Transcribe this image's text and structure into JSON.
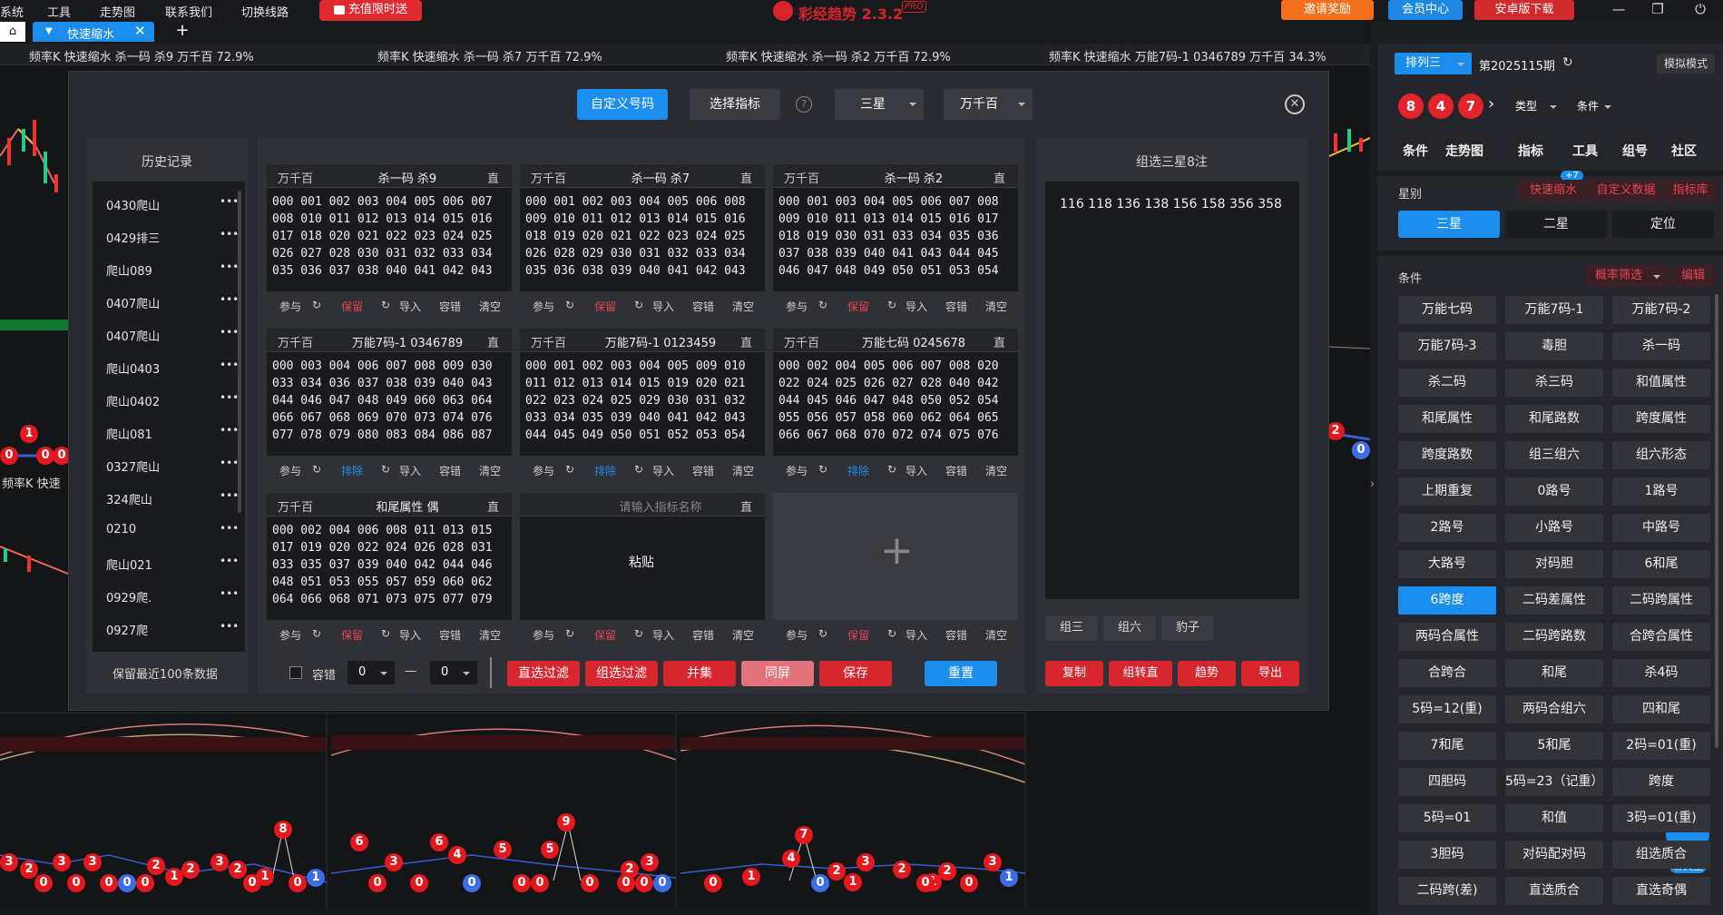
{
  "menu": [
    "系统",
    "工具",
    "走势图",
    "联系我们",
    "切换线路"
  ],
  "recharge": "充值限时送",
  "brand": {
    "name": "彩经趋势 2.3.2",
    "badge": "PRO"
  },
  "invite": "邀请奖励",
  "member": "会员中心",
  "android": "安卓版下载",
  "tabs": {
    "active": "快速缩水"
  },
  "chart_headers": [
    "频率K 快速缩水 杀一码 杀9 万千百 72.9%",
    "频率K 快速缩水 杀一码 杀7 万千百 72.9%",
    "频率K 快速缩水 杀一码 杀2 万千百 72.9%",
    "频率K 快速缩水 万能7码-1 0346789 万千百 34.3%"
  ],
  "chart_label_small": "频率K 快速",
  "dialog": {
    "custom_btn": "自定义号码",
    "select_btn": "选择指标",
    "help_icon": "?",
    "star_select": "三星",
    "pos_select": "万千百"
  },
  "history": {
    "title": "历史记录",
    "items": [
      "0430爬山",
      "0429排三",
      "爬山089",
      "0407爬山",
      "0407爬山",
      "爬山0403",
      "爬山0402",
      "爬山081",
      "0327爬山",
      "324爬山",
      "0210",
      "爬山021",
      "0929爬.",
      "0927爬"
    ],
    "dots": "•••",
    "footer": "保留最近100条数据"
  },
  "filters": [
    {
      "pos": "万千百",
      "name": "杀一码 杀9",
      "mode": "直",
      "nums": "000 001 002 003 004 005 006 007\n008 010 011 012 013 014 015 016\n017 018 020 021 022 023 024 025\n026 027 028 030 031 032 033 034\n035 036 037 038 040 041 042 043",
      "act": "保留"
    },
    {
      "pos": "万千百",
      "name": "杀一码 杀7",
      "mode": "直",
      "nums": "000 001 002 003 004 005 006 008\n009 010 011 012 013 014 015 016\n018 019 020 021 022 023 024 025\n026 028 029 030 031 032 033 034\n035 036 038 039 040 041 042 043",
      "act": "保留"
    },
    {
      "pos": "万千百",
      "name": "杀一码 杀2",
      "mode": "直",
      "nums": "000 001 003 004 005 006 007 008\n009 010 011 013 014 015 016 017\n018 019 030 031 033 034 035 036\n037 038 039 040 041 043 044 045\n046 047 048 049 050 051 053 054",
      "act": "保留"
    },
    {
      "pos": "万千百",
      "name": "万能7码-1 0346789",
      "mode": "直",
      "nums": "000 003 004 006 007 008 009 030\n033 034 036 037 038 039 040 043\n044 046 047 048 049 060 063 064\n066 067 068 069 070 073 074 076\n077 078 079 080 083 084 086 087",
      "act": "排除"
    },
    {
      "pos": "万千百",
      "name": "万能7码-1 0123459",
      "mode": "直",
      "nums": "000 001 002 003 004 005 009 010\n011 012 013 014 015 019 020 021\n022 023 024 025 029 030 031 032\n033 034 035 039 040 041 042 043\n044 045 049 050 051 052 053 054",
      "act": "排除"
    },
    {
      "pos": "万千百",
      "name": "万能七码 0245678",
      "mode": "直",
      "nums": "000 002 004 005 006 007 008 020\n022 024 025 026 027 028 040 042\n044 045 046 047 048 050 052 054\n055 056 057 058 060 062 064 065\n066 067 068 070 072 074 075 076",
      "act": "排除"
    },
    {
      "pos": "万千百",
      "name": "和尾属性 偶",
      "mode": "直",
      "nums": "000 002 004 006 008 011 013 015\n017 019 020 022 024 026 028 031\n033 035 037 039 040 042 044 046\n048 051 053 055 057 059 060 062\n064 066 068 071 073 075 077 079",
      "act": "保留"
    },
    {
      "pos": "",
      "name": "请输入指标名称",
      "mode": "直",
      "nums": "",
      "act": "保留",
      "paste": "粘贴"
    }
  ],
  "bar_labels": {
    "join": "参与",
    "import": "导入",
    "fault": "容错",
    "clear": "清空"
  },
  "bottom": {
    "fault": "容错",
    "from": "0",
    "dash": "—",
    "to": "0",
    "buttons": [
      "直选过滤",
      "组选过滤",
      "并集",
      "同屏",
      "保存"
    ],
    "reset": "重置"
  },
  "summary": {
    "title": "组选三星8注",
    "nums": "116 118 136 138 156 158 356 358",
    "tabs": [
      "组三",
      "组六",
      "豹子"
    ],
    "buttons": [
      "复制",
      "组转直",
      "趋势",
      "导出"
    ]
  },
  "sidebar": {
    "lottery": "排列三",
    "period": "第2025115期",
    "sim": "模拟模式",
    "balls": [
      "8",
      "4",
      "7"
    ],
    "type": "类型",
    "cond": "条件",
    "nav": [
      "条件",
      "走势图",
      "指标",
      "工具",
      "组号",
      "社区"
    ],
    "star_label": "星别",
    "badge": "+7",
    "tags": [
      "快速缩水",
      "自定义数据",
      "指标库"
    ],
    "star_tabs": [
      "三星",
      "二星",
      "定位"
    ],
    "cond_label": "条件",
    "prob": "概率筛选",
    "edit": "编辑",
    "buttons": [
      "万能七码",
      "万能7码-1",
      "万能7码-2",
      "万能7码-3",
      "毒胆",
      "杀一码",
      "杀二码",
      "杀三码",
      "和值属性",
      "和尾属性",
      "和尾路数",
      "跨度属性",
      "跨度路数",
      "组三组六",
      "组六形态",
      "上期重复",
      "0路号",
      "1路号",
      "2路号",
      "小路号",
      "中路号",
      "大路号",
      "对码胆",
      "6和尾",
      "6跨度",
      "二码差属性",
      "二码跨属性",
      "两码合属性",
      "二码跨路数",
      "合跨合属性",
      "合跨合",
      "和尾",
      "杀4码",
      "5码=12(重)",
      "两码合组六",
      "四和尾",
      "7和尾",
      "5和尾",
      "2码=01(重)",
      "四胆码",
      "5码=23（记重）",
      "跨度",
      "5码=01",
      "和值",
      "3码=01(重)",
      "3胆码",
      "对码配对码",
      "组选质合",
      "二码跨(差)",
      "直选质合",
      "直选奇偶"
    ],
    "chat": "聊天室"
  },
  "red_balls_chart1": [
    "1"
  ],
  "red_balls_chart2": [
    "2"
  ],
  "bottom_balls": [
    "3",
    "2",
    "3",
    "3",
    "2",
    "1",
    "2",
    "8",
    "3",
    "2",
    "1",
    "6",
    "3",
    "6",
    "4",
    "5",
    "9",
    "5",
    "2",
    "3",
    "1",
    "7",
    "4",
    "2",
    "1",
    "3",
    "2",
    "1",
    "2",
    "3"
  ]
}
